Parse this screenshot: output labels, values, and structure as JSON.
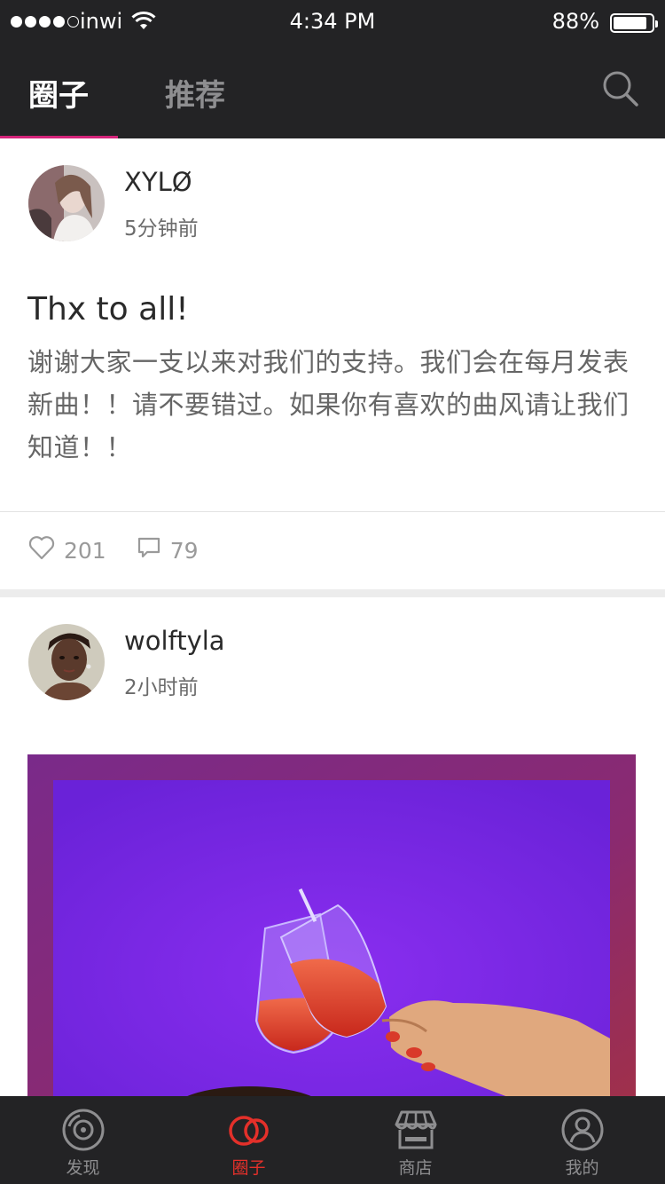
{
  "status_bar": {
    "carrier": "inwi",
    "time": "4:34 PM",
    "battery": "88%",
    "battery_level": 0.88
  },
  "top_nav": {
    "tabs": [
      {
        "label": "圈子",
        "active": true
      },
      {
        "label": "推荐",
        "active": false
      }
    ],
    "search_icon": "search-icon",
    "accent_color": "#d4237a"
  },
  "posts": [
    {
      "username": "XYLØ",
      "time": "5分钟前",
      "title": "Thx to all!",
      "body": "谢谢大家一支以来对我们的支持。我们会在每月发表新曲！！请不要错过。如果你有喜欢的曲风请让我们知道！！",
      "likes": "201",
      "comments": "79"
    },
    {
      "username": "wolftyla",
      "time": "2小时前"
    }
  ],
  "tabbar": {
    "items": [
      {
        "label": "发现",
        "icon": "disc-icon",
        "active": false
      },
      {
        "label": "圈子",
        "icon": "circles-icon",
        "active": true
      },
      {
        "label": "商店",
        "icon": "store-icon",
        "active": false
      },
      {
        "label": "我的",
        "icon": "profile-icon",
        "active": false
      }
    ],
    "active_color": "#e4302a"
  }
}
